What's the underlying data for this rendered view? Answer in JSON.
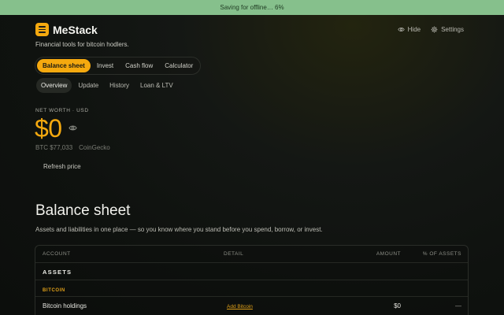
{
  "offline_banner": "Saving for offline… 6%",
  "brand": {
    "name": "MeStack",
    "tagline": "Financial tools for bitcoin hodlers."
  },
  "header_actions": {
    "hide": "Hide",
    "settings": "Settings"
  },
  "main_tabs": [
    "Balance sheet",
    "Invest",
    "Cash flow",
    "Calculator"
  ],
  "sub_tabs": [
    "Overview",
    "Update",
    "History",
    "Loan & LTV"
  ],
  "net_worth": {
    "label": "NET WORTH · USD",
    "value": "$0",
    "btc_price": "BTC $77,033",
    "source": "CoinGecko",
    "refresh": "Refresh price"
  },
  "balance_sheet": {
    "title": "Balance sheet",
    "description": "Assets and liabilities in one place — so you know where you stand before you spend, borrow, or invest.",
    "columns": [
      "ACCOUNT",
      "DETAIL",
      "AMOUNT",
      "% OF ASSETS"
    ],
    "section": "ASSETS",
    "group": "BITCOIN",
    "rows": [
      {
        "account": "Bitcoin holdings",
        "detail": "Add Bitcoin",
        "amount": "$0",
        "pct": "—"
      }
    ]
  },
  "colors": {
    "accent": "#f5a90f",
    "banner": "#86c08c",
    "background": "#0f120f"
  },
  "icons": {
    "hide": "eye-icon",
    "settings": "gear-icon",
    "logo": "stack-icon"
  }
}
